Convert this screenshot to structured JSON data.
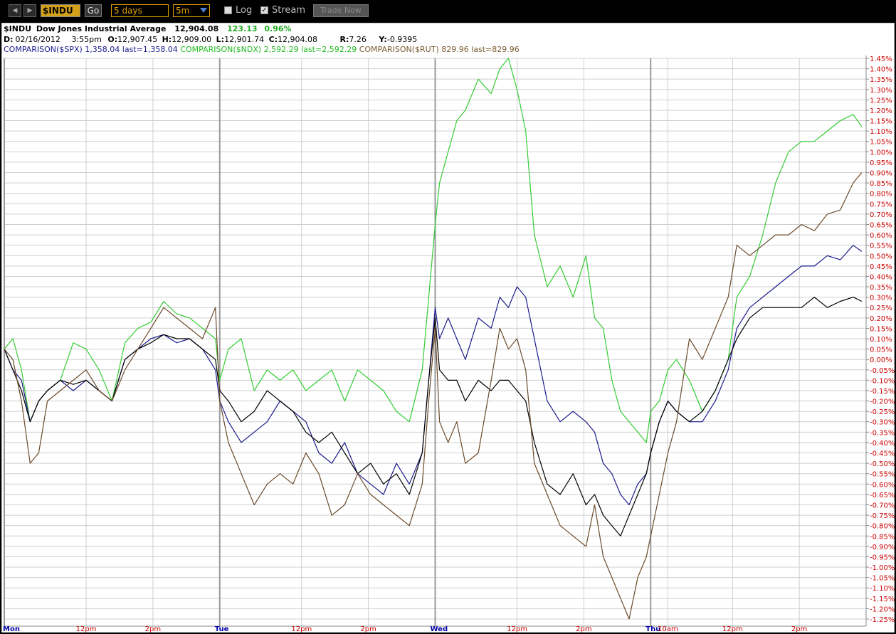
{
  "toolbar": {
    "symbol": "$INDU",
    "go_label": "Go",
    "range": "5 days",
    "interval": "5m",
    "log_label": "Log",
    "log_checked": false,
    "stream_label": "Stream",
    "stream_checked": true,
    "trade_label": "Trade Now"
  },
  "header": {
    "title_symbol": "$INDU",
    "title_name": "Dow Jones Industrial Average",
    "last": "12,904.08",
    "change": "123.13",
    "change_pct": "0.96%",
    "date_label": "D:",
    "date": "02/16/2012",
    "time": "3:55pm",
    "open_label": "O:",
    "open": "12,907.45",
    "high_label": "H:",
    "high": "12,909.00",
    "low_label": "L:",
    "low": "12,901.74",
    "close_label": "C:",
    "close": "12,904.08",
    "r_label": "R:",
    "r": "7.26",
    "y_label": "Y:",
    "y": "-0.9395",
    "comparisons": [
      {
        "label": "COMPARISON($SPX)",
        "value": "1,358.04",
        "last": "last=1,358.04",
        "color": "#1a1a8c"
      },
      {
        "label": "COMPARISON($NDX)",
        "value": "2,592.29",
        "last": "last=2,592.29",
        "color": "#22bb22"
      },
      {
        "label": "COMPARISON($RUT)",
        "value": "829.96",
        "last": "last=829.96",
        "color": "#7a5a30"
      }
    ]
  },
  "colors": {
    "indu": "#000000",
    "spx": "#1a1a8c",
    "ndx": "#33cc33",
    "rut": "#6b4a2a",
    "axis_label": "#cc0000",
    "day_label": "#0000aa",
    "grid": "#cfcfcf"
  },
  "chart_data": {
    "type": "line",
    "ylim": [
      -1.25,
      1.45
    ],
    "y_ticks": [
      "1.45%",
      "1.40%",
      "1.35%",
      "1.30%",
      "1.25%",
      "1.20%",
      "1.15%",
      "1.10%",
      "1.05%",
      "1.00%",
      "0.95%",
      "0.90%",
      "0.85%",
      "0.80%",
      "0.75%",
      "0.70%",
      "0.65%",
      "0.60%",
      "0.55%",
      "0.50%",
      "0.45%",
      "0.40%",
      "0.35%",
      "0.30%",
      "0.25%",
      "0.20%",
      "0.15%",
      "0.10%",
      "0.05%",
      "0.00%",
      "-0.05%",
      "-0.10%",
      "-0.15%",
      "-0.20%",
      "-0.25%",
      "-0.30%",
      "-0.35%",
      "-0.40%",
      "-0.45%",
      "-0.50%",
      "-0.55%",
      "-0.60%",
      "-0.65%",
      "-0.70%",
      "-0.75%",
      "-0.80%",
      "-0.85%",
      "-0.90%",
      "-0.95%",
      "-1.00%",
      "-1.05%",
      "-1.10%",
      "-1.15%",
      "-1.20%",
      "-1.25%"
    ],
    "x_range": [
      0,
      4
    ],
    "x_labels": [
      {
        "text": "Mon",
        "x": 0.0,
        "day": true
      },
      {
        "text": "12pm",
        "x": 0.38,
        "day": false
      },
      {
        "text": "2pm",
        "x": 0.69,
        "day": false
      },
      {
        "text": "Tue",
        "x": 1.0,
        "day": true
      },
      {
        "text": "12pm",
        "x": 1.38,
        "day": false
      },
      {
        "text": "2pm",
        "x": 1.69,
        "day": false
      },
      {
        "text": "Wed",
        "x": 2.0,
        "day": true
      },
      {
        "text": "12pm",
        "x": 2.38,
        "day": false
      },
      {
        "text": "2pm",
        "x": 2.69,
        "day": false
      },
      {
        "text": "Thu",
        "x": 3.0,
        "day": true
      },
      {
        "text": "10am",
        "x": 3.08,
        "day": false
      },
      {
        "text": "12pm",
        "x": 3.38,
        "day": false
      },
      {
        "text": "2pm",
        "x": 3.69,
        "day": false
      }
    ],
    "series": [
      {
        "key": "ndx",
        "x": [
          0,
          0.04,
          0.08,
          0.12,
          0.16,
          0.2,
          0.26,
          0.32,
          0.38,
          0.44,
          0.5,
          0.56,
          0.62,
          0.68,
          0.74,
          0.8,
          0.86,
          0.92,
          0.98,
          1.0,
          1.04,
          1.1,
          1.16,
          1.22,
          1.28,
          1.34,
          1.4,
          1.46,
          1.52,
          1.58,
          1.64,
          1.7,
          1.76,
          1.82,
          1.88,
          1.94,
          1.97,
          2.0,
          2.02,
          2.06,
          2.1,
          2.14,
          2.2,
          2.26,
          2.3,
          2.34,
          2.38,
          2.42,
          2.46,
          2.52,
          2.58,
          2.64,
          2.7,
          2.74,
          2.78,
          2.82,
          2.86,
          2.9,
          2.94,
          2.98,
          3.0,
          3.04,
          3.08,
          3.12,
          3.18,
          3.24,
          3.3,
          3.36,
          3.4,
          3.46,
          3.52,
          3.58,
          3.64,
          3.7,
          3.76,
          3.82,
          3.88,
          3.94,
          3.98
        ],
        "y": [
          0.05,
          0.1,
          -0.05,
          -0.3,
          -0.2,
          -0.15,
          -0.1,
          0.08,
          0.05,
          -0.05,
          -0.2,
          0.08,
          0.15,
          0.18,
          0.28,
          0.22,
          0.2,
          0.15,
          0.1,
          -0.1,
          0.05,
          0.1,
          -0.15,
          -0.05,
          -0.1,
          -0.05,
          -0.15,
          -0.1,
          -0.05,
          -0.2,
          -0.05,
          -0.1,
          -0.15,
          -0.25,
          -0.3,
          -0.05,
          0.3,
          0.65,
          0.85,
          1.0,
          1.15,
          1.2,
          1.35,
          1.28,
          1.4,
          1.45,
          1.3,
          1.1,
          0.6,
          0.35,
          0.45,
          0.3,
          0.5,
          0.2,
          0.15,
          -0.1,
          -0.25,
          -0.3,
          -0.35,
          -0.4,
          -0.25,
          -0.2,
          -0.05,
          0.0,
          -0.1,
          -0.25,
          -0.15,
          0.0,
          0.3,
          0.4,
          0.6,
          0.85,
          1.0,
          1.05,
          1.05,
          1.1,
          1.15,
          1.18,
          1.12
        ],
        "color": "#33cc33"
      },
      {
        "key": "spx",
        "x": [
          0,
          0.04,
          0.08,
          0.12,
          0.16,
          0.2,
          0.26,
          0.32,
          0.38,
          0.44,
          0.5,
          0.56,
          0.62,
          0.68,
          0.74,
          0.8,
          0.86,
          0.92,
          0.98,
          1.0,
          1.04,
          1.1,
          1.16,
          1.22,
          1.28,
          1.34,
          1.4,
          1.46,
          1.52,
          1.58,
          1.64,
          1.7,
          1.76,
          1.82,
          1.88,
          1.94,
          1.97,
          2.0,
          2.02,
          2.06,
          2.1,
          2.14,
          2.2,
          2.26,
          2.3,
          2.34,
          2.38,
          2.42,
          2.46,
          2.52,
          2.58,
          2.64,
          2.7,
          2.74,
          2.78,
          2.82,
          2.86,
          2.9,
          2.94,
          2.98,
          3.0,
          3.04,
          3.08,
          3.12,
          3.18,
          3.24,
          3.3,
          3.36,
          3.4,
          3.46,
          3.52,
          3.58,
          3.64,
          3.7,
          3.76,
          3.82,
          3.88,
          3.94,
          3.98
        ],
        "y": [
          0.05,
          -0.05,
          -0.1,
          -0.3,
          -0.2,
          -0.15,
          -0.1,
          -0.15,
          -0.1,
          -0.15,
          -0.2,
          0.0,
          0.05,
          0.1,
          0.12,
          0.08,
          0.1,
          0.05,
          -0.05,
          -0.2,
          -0.3,
          -0.4,
          -0.35,
          -0.3,
          -0.2,
          -0.25,
          -0.3,
          -0.45,
          -0.5,
          -0.4,
          -0.55,
          -0.6,
          -0.65,
          -0.5,
          -0.6,
          -0.45,
          -0.1,
          0.25,
          0.1,
          0.2,
          0.1,
          0.0,
          0.2,
          0.15,
          0.3,
          0.25,
          0.35,
          0.3,
          0.1,
          -0.2,
          -0.3,
          -0.25,
          -0.3,
          -0.35,
          -0.5,
          -0.55,
          -0.65,
          -0.7,
          -0.6,
          -0.55,
          -0.45,
          -0.3,
          -0.2,
          -0.25,
          -0.3,
          -0.3,
          -0.2,
          -0.05,
          0.15,
          0.25,
          0.3,
          0.35,
          0.4,
          0.45,
          0.45,
          0.5,
          0.48,
          0.55,
          0.52
        ],
        "color": "#1a1a8c"
      },
      {
        "key": "indu",
        "x": [
          0,
          0.04,
          0.08,
          0.12,
          0.16,
          0.2,
          0.26,
          0.32,
          0.38,
          0.44,
          0.5,
          0.56,
          0.62,
          0.68,
          0.74,
          0.8,
          0.86,
          0.92,
          0.98,
          1.0,
          1.04,
          1.1,
          1.16,
          1.22,
          1.28,
          1.34,
          1.4,
          1.46,
          1.52,
          1.58,
          1.64,
          1.7,
          1.76,
          1.82,
          1.88,
          1.94,
          1.97,
          2.0,
          2.02,
          2.06,
          2.1,
          2.14,
          2.2,
          2.26,
          2.3,
          2.34,
          2.38,
          2.42,
          2.46,
          2.52,
          2.58,
          2.64,
          2.7,
          2.74,
          2.78,
          2.82,
          2.86,
          2.9,
          2.94,
          2.98,
          3.0,
          3.04,
          3.08,
          3.12,
          3.18,
          3.24,
          3.3,
          3.36,
          3.4,
          3.46,
          3.52,
          3.58,
          3.64,
          3.7,
          3.76,
          3.82,
          3.88,
          3.94,
          3.98
        ],
        "y": [
          0.05,
          -0.05,
          -0.15,
          -0.3,
          -0.2,
          -0.15,
          -0.1,
          -0.12,
          -0.1,
          -0.15,
          -0.2,
          0.0,
          0.05,
          0.08,
          0.12,
          0.1,
          0.1,
          0.05,
          0.0,
          -0.15,
          -0.2,
          -0.3,
          -0.25,
          -0.15,
          -0.2,
          -0.25,
          -0.35,
          -0.4,
          -0.35,
          -0.45,
          -0.55,
          -0.5,
          -0.6,
          -0.55,
          -0.65,
          -0.45,
          -0.1,
          0.2,
          -0.05,
          -0.1,
          -0.1,
          -0.2,
          -0.1,
          -0.15,
          -0.1,
          -0.1,
          -0.15,
          -0.2,
          -0.4,
          -0.6,
          -0.65,
          -0.55,
          -0.7,
          -0.65,
          -0.75,
          -0.8,
          -0.85,
          -0.75,
          -0.65,
          -0.55,
          -0.45,
          -0.3,
          -0.2,
          -0.25,
          -0.3,
          -0.25,
          -0.15,
          0.0,
          0.1,
          0.2,
          0.25,
          0.25,
          0.25,
          0.25,
          0.3,
          0.25,
          0.28,
          0.3,
          0.28
        ],
        "color": "#000000"
      },
      {
        "key": "rut",
        "x": [
          0,
          0.04,
          0.08,
          0.12,
          0.16,
          0.2,
          0.26,
          0.32,
          0.38,
          0.44,
          0.5,
          0.56,
          0.62,
          0.68,
          0.74,
          0.8,
          0.86,
          0.92,
          0.98,
          1.0,
          1.04,
          1.1,
          1.16,
          1.22,
          1.28,
          1.34,
          1.4,
          1.46,
          1.52,
          1.58,
          1.64,
          1.7,
          1.76,
          1.82,
          1.88,
          1.94,
          1.97,
          2.0,
          2.02,
          2.06,
          2.1,
          2.14,
          2.2,
          2.26,
          2.3,
          2.34,
          2.38,
          2.42,
          2.46,
          2.52,
          2.58,
          2.64,
          2.7,
          2.74,
          2.78,
          2.82,
          2.86,
          2.9,
          2.94,
          2.98,
          3.0,
          3.04,
          3.08,
          3.12,
          3.18,
          3.24,
          3.3,
          3.36,
          3.4,
          3.46,
          3.52,
          3.58,
          3.64,
          3.7,
          3.76,
          3.82,
          3.88,
          3.94,
          3.98
        ],
        "y": [
          0.05,
          0.0,
          -0.2,
          -0.5,
          -0.45,
          -0.2,
          -0.15,
          -0.1,
          -0.05,
          -0.15,
          -0.2,
          -0.05,
          0.05,
          0.15,
          0.25,
          0.2,
          0.15,
          0.1,
          0.25,
          -0.2,
          -0.4,
          -0.55,
          -0.7,
          -0.6,
          -0.55,
          -0.6,
          -0.45,
          -0.55,
          -0.75,
          -0.7,
          -0.55,
          -0.65,
          -0.7,
          -0.75,
          -0.8,
          -0.6,
          -0.2,
          0.15,
          -0.3,
          -0.4,
          -0.3,
          -0.5,
          -0.45,
          -0.1,
          0.15,
          0.05,
          0.1,
          -0.05,
          -0.5,
          -0.65,
          -0.8,
          -0.85,
          -0.9,
          -0.7,
          -0.95,
          -1.05,
          -1.15,
          -1.25,
          -1.05,
          -0.95,
          -0.85,
          -0.65,
          -0.45,
          -0.3,
          0.1,
          0.0,
          0.15,
          0.3,
          0.55,
          0.5,
          0.55,
          0.6,
          0.6,
          0.65,
          0.62,
          0.7,
          0.72,
          0.85,
          0.9
        ],
        "color": "#6b4a2a"
      }
    ]
  }
}
